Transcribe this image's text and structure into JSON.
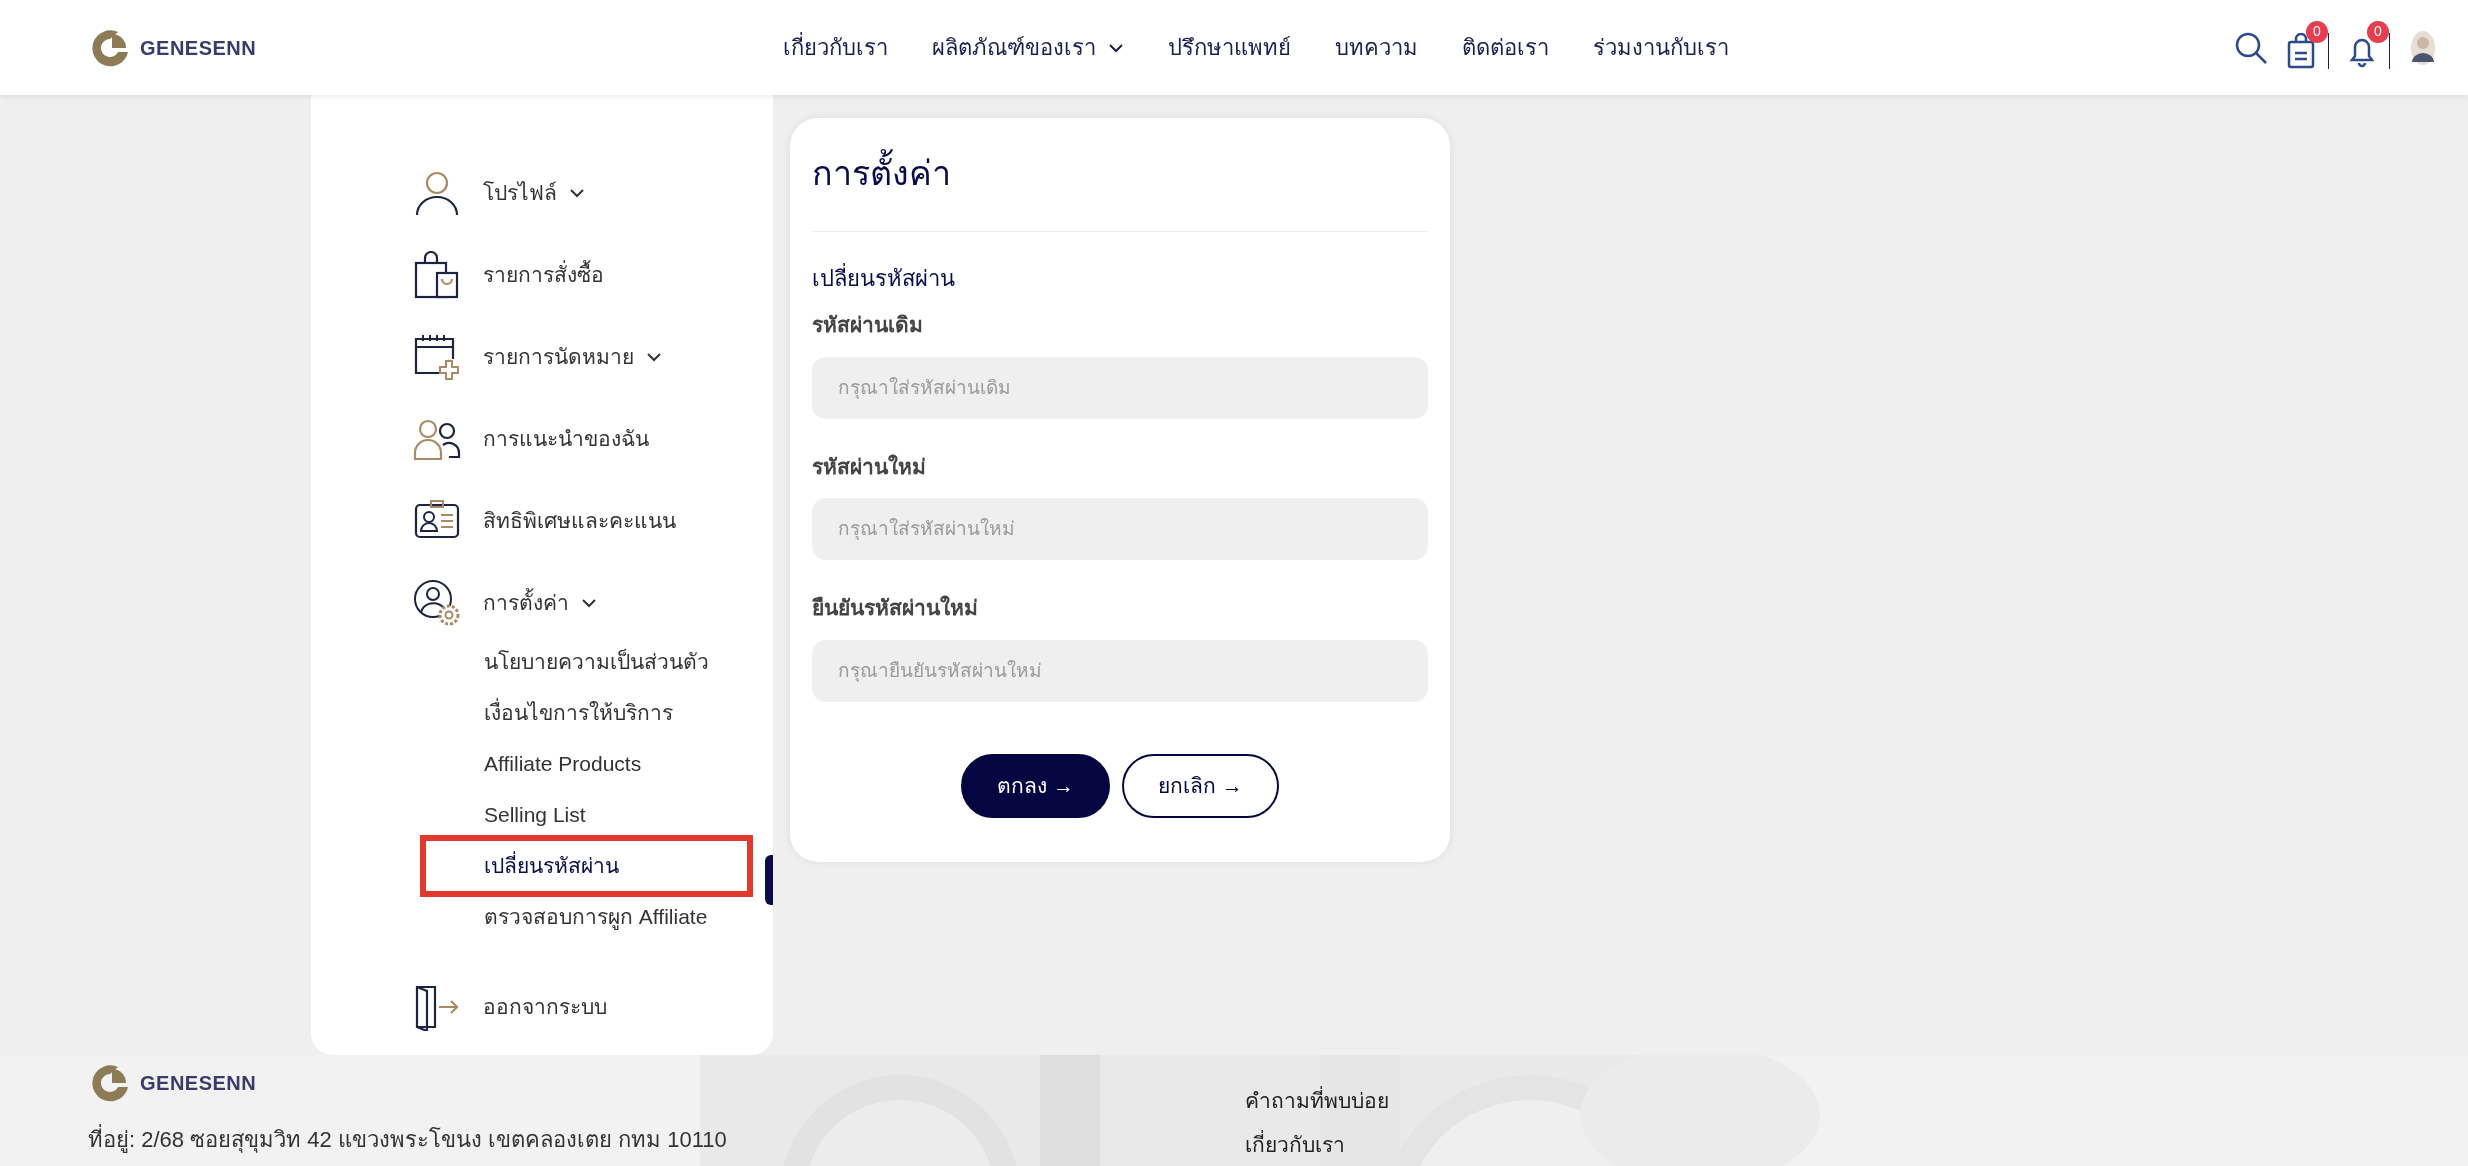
{
  "header": {
    "logo": "GENESENN",
    "nav": [
      {
        "label": "เกี่ยวกับเรา",
        "has_dropdown": false
      },
      {
        "label": "ผลิตภัณฑ์ของเรา",
        "has_dropdown": true
      },
      {
        "label": "ปรึกษาแพทย์",
        "has_dropdown": false
      },
      {
        "label": "บทความ",
        "has_dropdown": false
      },
      {
        "label": "ติดต่อเรา",
        "has_dropdown": false
      },
      {
        "label": "ร่วมงานกับเรา",
        "has_dropdown": false
      }
    ],
    "cart_count": "0",
    "notification_count": "0"
  },
  "sidebar": {
    "items": [
      {
        "label": "โปรไฟล์",
        "has_dropdown": true
      },
      {
        "label": "รายการสั่งซื้อ",
        "has_dropdown": false
      },
      {
        "label": "รายการนัดหมาย",
        "has_dropdown": true
      },
      {
        "label": "การแนะนำของฉัน",
        "has_dropdown": false
      },
      {
        "label": "สิทธิพิเศษและคะแนน",
        "has_dropdown": false
      },
      {
        "label": "การตั้งค่า",
        "has_dropdown": true,
        "children": [
          {
            "label": "นโยบายความเป็นส่วนตัว",
            "selected": false
          },
          {
            "label": "เงื่อนไขการให้บริการ",
            "selected": false
          },
          {
            "label": "Affiliate Products",
            "selected": false
          },
          {
            "label": "Selling List",
            "selected": false
          },
          {
            "label": "เปลี่ยนรหัสผ่าน",
            "selected": true
          },
          {
            "label": "ตรวจสอบการผูก Affiliate",
            "selected": false
          }
        ]
      },
      {
        "label": "ออกจากระบบ",
        "has_dropdown": false
      }
    ]
  },
  "settings_card": {
    "title": "การตั้งค่า",
    "section_title": "เปลี่ยนรหัสผ่าน",
    "fields": [
      {
        "label": "รหัสผ่านเดิม",
        "placeholder": "กรุณาใส่รหัสผ่านเดิม"
      },
      {
        "label": "รหัสผ่านใหม่",
        "placeholder": "กรุณาใส่รหัสผ่านใหม่"
      },
      {
        "label": "ยืนยันรหัสผ่านใหม่",
        "placeholder": "กรุณายืนยันรหัสผ่านใหม่"
      }
    ],
    "buttons": [
      {
        "label": "ตกลง →",
        "kind": "primary"
      },
      {
        "label": "ยกเลิก →",
        "kind": "outline"
      }
    ]
  },
  "footer": {
    "logo": "GENESENN",
    "address": "ที่อยู่: 2/68 ซอยสุขุมวิท 42 แขวงพระโขนง เขตคลองเตย กทม 10110",
    "links": [
      "คำถามที่พบบ่อย",
      "เกี่ยวกับเรา"
    ]
  }
}
